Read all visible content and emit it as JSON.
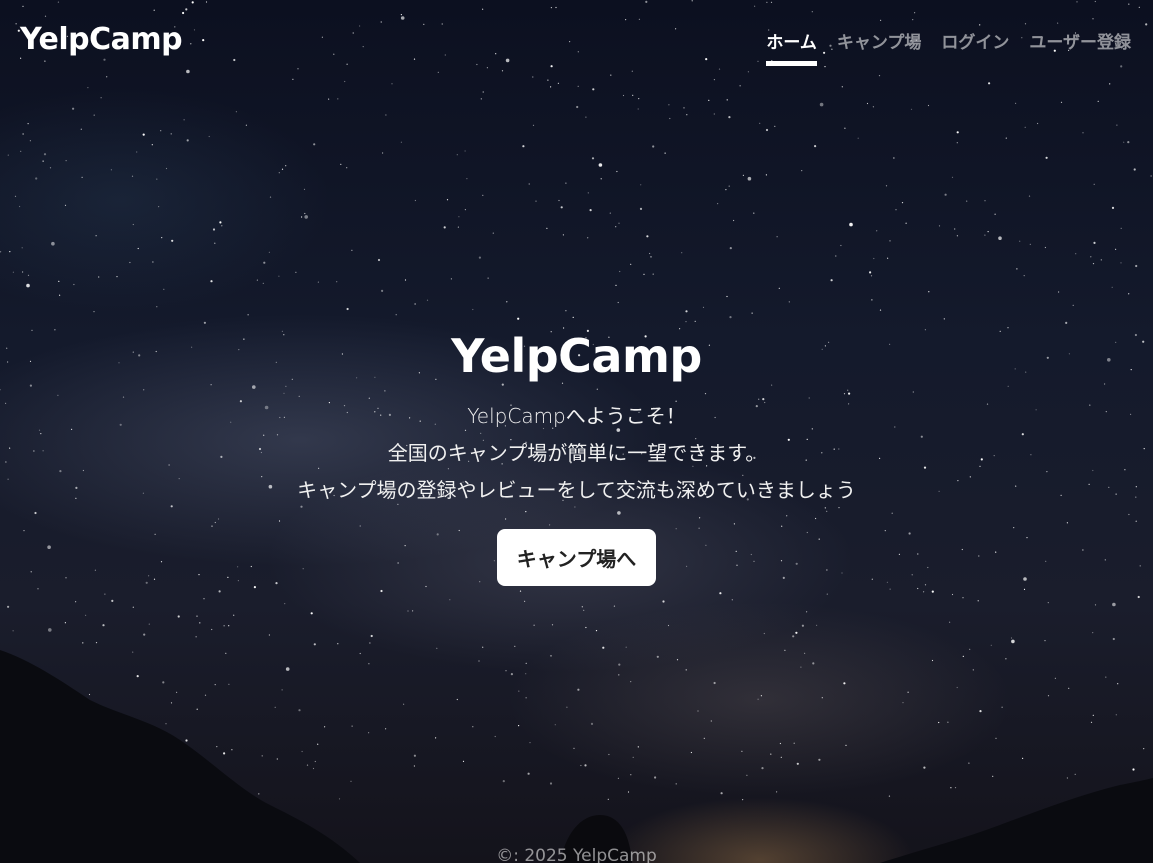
{
  "brand": "YelpCamp",
  "nav": {
    "items": [
      {
        "label": "ホーム",
        "active": true
      },
      {
        "label": "キャンプ場",
        "active": false
      },
      {
        "label": "ログイン",
        "active": false
      },
      {
        "label": "ユーザー登録",
        "active": false
      }
    ]
  },
  "hero": {
    "title": "YelpCamp",
    "lines": [
      "YelpCampへようこそ！",
      "全国のキャンプ場が簡単に一望できます。",
      "キャンプ場の登録やレビューをして交流も深めていきましょう"
    ],
    "button_label": "キャンプ場へ"
  },
  "footer": {
    "text": "©: 2025 YelpCamp"
  }
}
